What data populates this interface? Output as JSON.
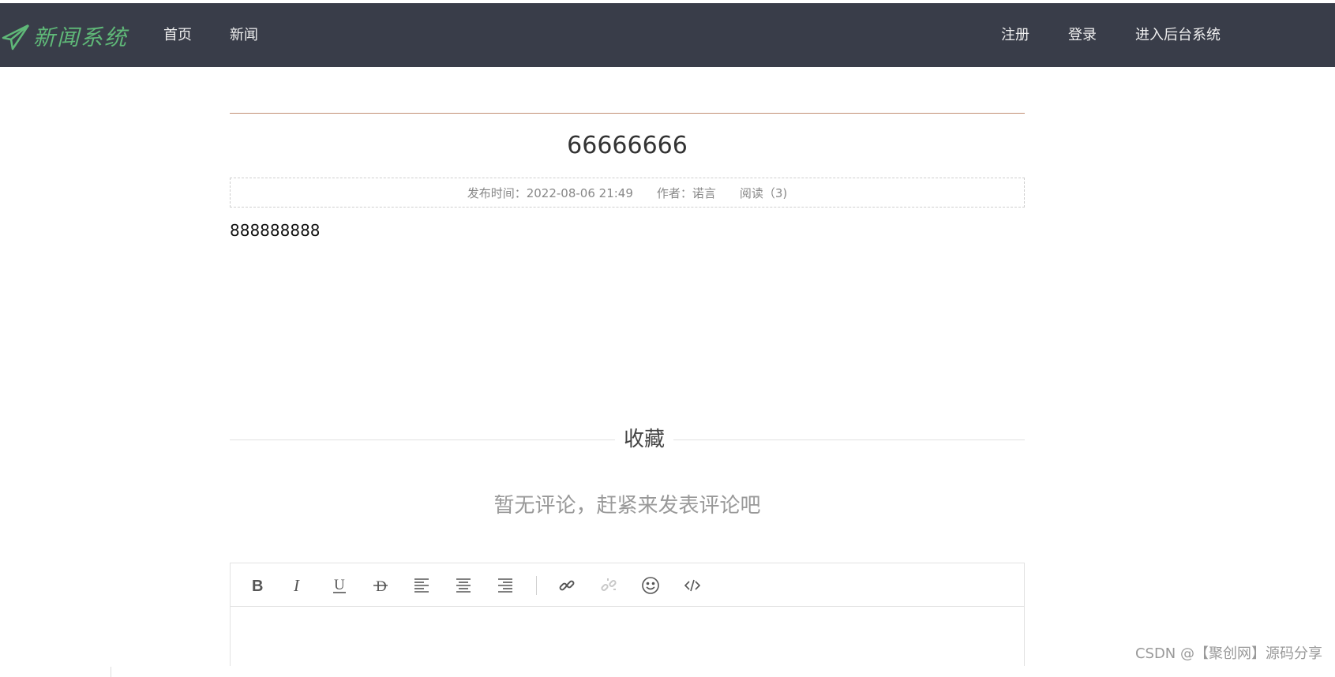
{
  "nav": {
    "logo_text": "新闻系统",
    "home": "首页",
    "news": "新闻",
    "register": "注册",
    "login": "登录",
    "admin": "进入后台系统"
  },
  "article": {
    "title": "66666666",
    "publish_time": "发布时间：2022-08-06 21:49",
    "author": "作者：诺言",
    "reads": "阅读（3)",
    "content": "888888888"
  },
  "favorite_label": "收藏",
  "no_comment_text": "暂无评论，赶紧来发表评论吧",
  "editor": {
    "tools": [
      "bold-icon",
      "italic-icon",
      "underline-icon",
      "strikethrough-icon",
      "align-left-icon",
      "align-center-icon",
      "align-right-icon",
      "link-icon",
      "unlink-icon",
      "emoji-icon",
      "code-icon"
    ]
  },
  "watermark": "CSDN @【聚创网】源码分享",
  "colors": {
    "navbar_bg": "#393d49",
    "logo": "#5fb878",
    "title_line": "#c28f74"
  }
}
